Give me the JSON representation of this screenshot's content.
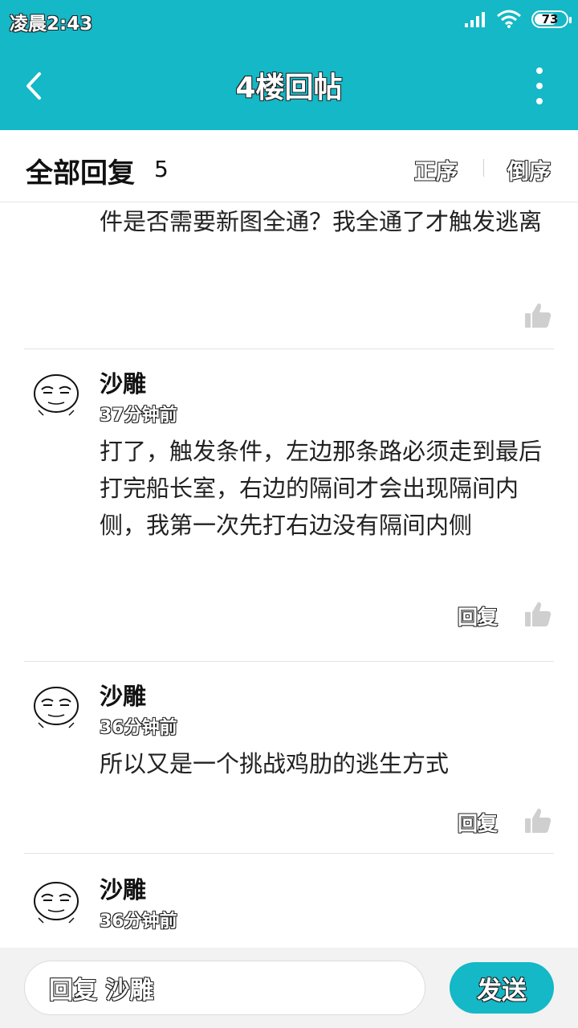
{
  "status_bar": {
    "time": "凌晨2:43",
    "battery": "73",
    "battery_level": 0.73
  },
  "nav": {
    "title": "4楼回帖"
  },
  "replies_header": {
    "title": "全部回复",
    "count": "5",
    "sort_asc": "正序",
    "sort_desc": "倒序"
  },
  "comments": [
    {
      "body": "件是否需要新图全通？我全通了才触发逃离"
    },
    {
      "name": "沙雕",
      "time": "37分钟前",
      "body": "打了，触发条件，左边那条路必须走到最后打完船长室，右边的隔间才会出现隔间内侧，我第一次先打右边没有隔间内侧",
      "reply": "回复"
    },
    {
      "name": "沙雕",
      "time": "36分钟前",
      "body": "所以又是一个挑战鸡肋的逃生方式",
      "reply": "回复"
    },
    {
      "name": "沙雕",
      "time": "36分钟前",
      "body": ""
    }
  ],
  "composer": {
    "placeholder": "回复 沙雕",
    "send_label": "发送"
  }
}
